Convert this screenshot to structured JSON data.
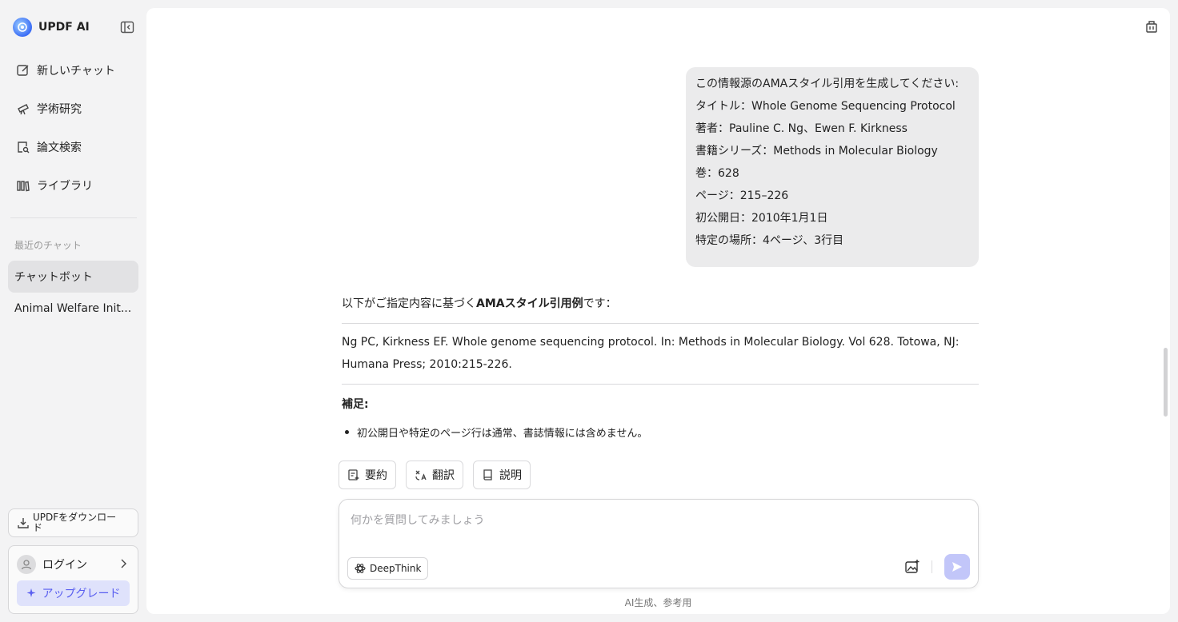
{
  "sidebar": {
    "brand": "UPDF AI",
    "nav": [
      {
        "label": "新しいチャット",
        "icon": "new-chat-icon"
      },
      {
        "label": "学術研究",
        "icon": "telescope-icon"
      },
      {
        "label": "論文検索",
        "icon": "document-search-icon"
      },
      {
        "label": "ライブラリ",
        "icon": "library-icon"
      }
    ],
    "recent_title": "最近のチャット",
    "recent": [
      {
        "label": "チャットボット",
        "active": true
      },
      {
        "label": "Animal Welfare Init...",
        "active": false
      }
    ],
    "download_label": "UPDFをダウンロード",
    "login_label": "ログイン",
    "upgrade_label": "アップグレード"
  },
  "chat": {
    "user_message": [
      "この情報源のAMAスタイル引用を生成してください:",
      "タイトル：Whole Genome Sequencing Protocol",
      "著者：Pauline C. Ng、Ewen F. Kirkness",
      "書籍シリーズ：Methods in Molecular Biology",
      "巻：628",
      "ページ：215–226",
      "初公開日：2010年1月1日",
      "特定の場所：4ページ、3行目"
    ],
    "answer": {
      "intro_prefix": "以下がご指定内容に基づく",
      "intro_bold": "AMAスタイル引用例",
      "intro_suffix": "です：",
      "citation_line1": "Ng PC, Kirkness EF. Whole genome sequencing protocol. In: Methods in Molecular Biology. Vol 628. Totowa, NJ:",
      "citation_line2": "Humana Press; 2010:215-226.",
      "note_title": "補足:",
      "notes": [
        "初公開日や特定のページ行は通常、書誌情報には含めません。"
      ]
    },
    "actions": [
      {
        "label": "要約",
        "icon": "summarize-icon"
      },
      {
        "label": "翻訳",
        "icon": "translate-icon"
      },
      {
        "label": "説明",
        "icon": "book-icon"
      }
    ]
  },
  "composer": {
    "placeholder": "何かを質問してみましょう",
    "value": "",
    "deepthink_label": "DeepThink"
  },
  "footer": "AI生成、参考用",
  "colors": {
    "accent": "#5a5ff0",
    "upgrade_bg": "#dfe2fb",
    "send_bg": "#c2c6f9",
    "bubble_bg": "#ebebec"
  }
}
